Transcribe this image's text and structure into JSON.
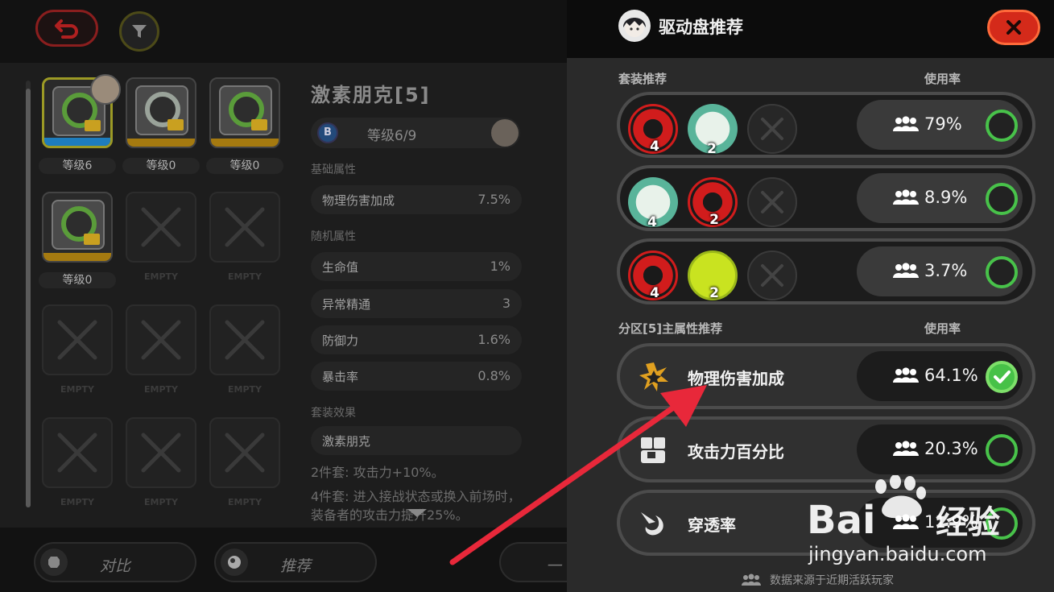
{
  "left": {
    "buttons": {
      "back": "back",
      "filter": "filter"
    },
    "slots": [
      {
        "label": "等级6",
        "state": "filled",
        "selected": true,
        "bar": "blue",
        "ring": "green"
      },
      {
        "label": "等级0",
        "state": "filled",
        "selected": false,
        "bar": "gold",
        "ring": "gray"
      },
      {
        "label": "等级0",
        "state": "filled",
        "selected": false,
        "bar": "gold",
        "ring": "green"
      },
      {
        "label": "等级0",
        "state": "filled",
        "selected": false,
        "bar": "gold",
        "ring": "green"
      },
      {
        "label": "EMPTY",
        "state": "empty"
      },
      {
        "label": "EMPTY",
        "state": "empty"
      },
      {
        "label": "EMPTY",
        "state": "empty"
      },
      {
        "label": "EMPTY",
        "state": "empty"
      },
      {
        "label": "EMPTY",
        "state": "empty"
      },
      {
        "label": "EMPTY",
        "state": "empty"
      },
      {
        "label": "EMPTY",
        "state": "empty"
      },
      {
        "label": "EMPTY",
        "state": "empty"
      }
    ],
    "detail": {
      "title": "激素朋克[5]",
      "badge": "B",
      "level": "等级6/9",
      "base_label": "基础属性",
      "base_stats": [
        {
          "name": "物理伤害加成",
          "value": "7.5%"
        }
      ],
      "random_label": "随机属性",
      "random_stats": [
        {
          "name": "生命值",
          "value": "1%"
        },
        {
          "name": "异常精通",
          "value": "3"
        },
        {
          "name": "防御力",
          "value": "1.6%"
        },
        {
          "name": "暴击率",
          "value": "0.8%"
        }
      ],
      "set_label": "套装效果",
      "set_name": "激素朋克",
      "set_2pc": "2件套: 攻击力+10%。",
      "set_4pc": "4件套: 进入接战状态或换入前场时，装备者的攻击力提升25%。"
    },
    "bottom": {
      "compare": "对比",
      "recommend": "推荐",
      "third": "一"
    }
  },
  "panel": {
    "title": "驱动盘推荐",
    "close_icon": "close-x-icon",
    "sets_header": "套装推荐",
    "rate_header": "使用率",
    "sets": [
      {
        "icons": [
          {
            "color": "red",
            "count": "4"
          },
          {
            "color": "teal",
            "count": "2"
          },
          {
            "color": "none",
            "count": ""
          }
        ],
        "rate": "79%",
        "checked": false
      },
      {
        "icons": [
          {
            "color": "teal",
            "count": "4"
          },
          {
            "color": "red",
            "count": "2"
          },
          {
            "color": "none",
            "count": ""
          }
        ],
        "rate": "8.9%",
        "checked": false
      },
      {
        "icons": [
          {
            "color": "red",
            "count": "4"
          },
          {
            "color": "lime",
            "count": "2"
          },
          {
            "color": "none",
            "count": ""
          }
        ],
        "rate": "3.7%",
        "checked": false
      }
    ],
    "attr_header": "分区[5]主属性推荐",
    "attr_rate_header": "使用率",
    "attrs": [
      {
        "name": "物理伤害加成",
        "icon": "physical-burst-icon",
        "rate": "64.1%",
        "checked": true
      },
      {
        "name": "攻击力百分比",
        "icon": "attack-fist-icon",
        "rate": "20.3%",
        "checked": false
      },
      {
        "name": "穿透率",
        "icon": "penetration-icon",
        "rate": "11.9%",
        "checked": false
      }
    ],
    "footer": "数据来源于近期活跃玩家"
  },
  "watermark": {
    "logo_text": "Bai经验",
    "url": "jingyan.baidu.com"
  },
  "colors": {
    "accent_red": "#d42a1a",
    "check_green": "#47c148",
    "arrow_red": "#e8283a"
  }
}
